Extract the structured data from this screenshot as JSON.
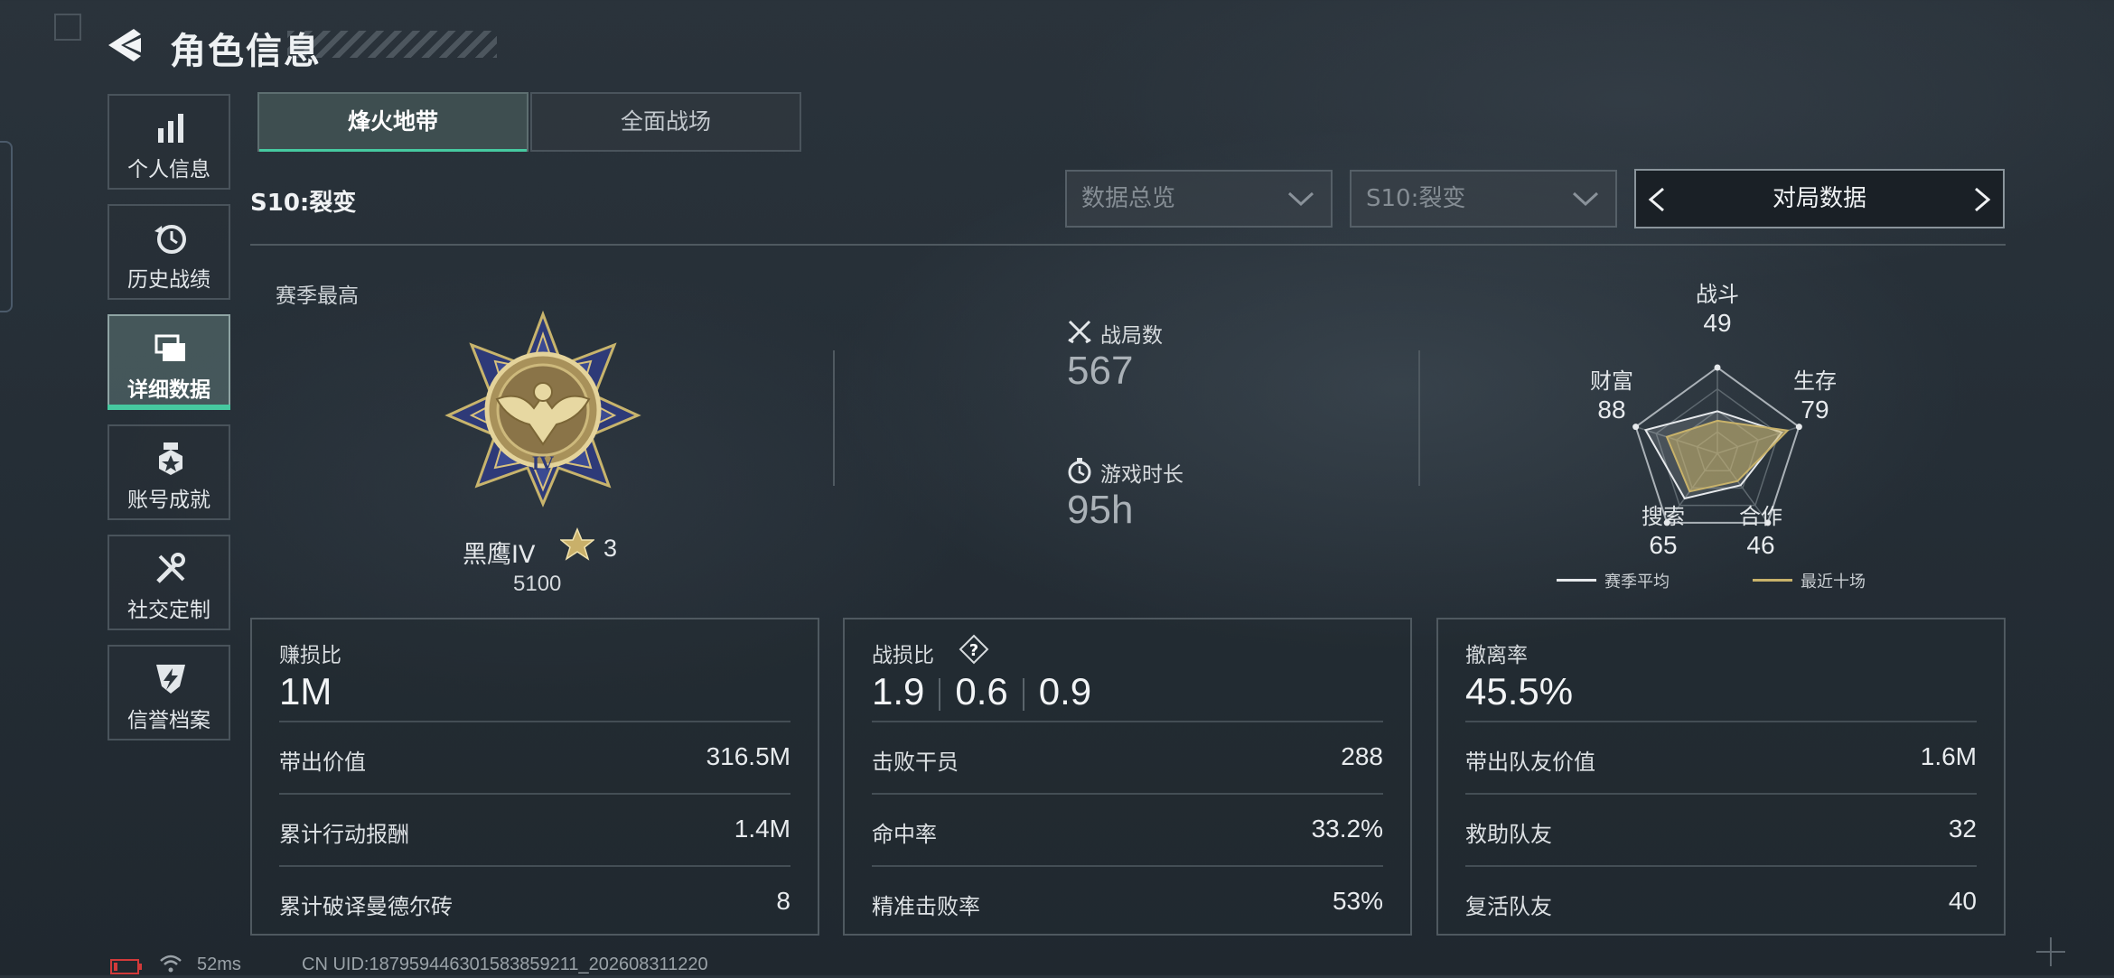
{
  "header": {
    "title": "角色信息"
  },
  "nav": [
    {
      "id": "profile",
      "label": "个人信息",
      "icon": "bar-chart-icon"
    },
    {
      "id": "history",
      "label": "历史战绩",
      "icon": "history-clock-icon"
    },
    {
      "id": "details",
      "label": "详细数据",
      "icon": "folders-icon",
      "active": true
    },
    {
      "id": "achievements",
      "label": "账号成就",
      "icon": "medal-icon"
    },
    {
      "id": "social",
      "label": "社交定制",
      "icon": "tools-icon"
    },
    {
      "id": "credit",
      "label": "信誉档案",
      "icon": "shield-lightning-icon"
    }
  ],
  "tabs": [
    {
      "label": "烽火地带",
      "active": true
    },
    {
      "label": "全面战场",
      "active": false
    }
  ],
  "season": {
    "label": "S10:裂变"
  },
  "filters": {
    "overview": "数据总览",
    "season": "S10:裂变",
    "mode": "对局数据"
  },
  "rank": {
    "peak_label": "赛季最高",
    "name": "黑鹰IV",
    "stars": "3",
    "score": "5100"
  },
  "stats": {
    "matches_label": "战局数",
    "matches": "567",
    "playtime_label": "游戏时长",
    "playtime": "95h"
  },
  "radar": {
    "axes": [
      {
        "label": "战斗",
        "value": "49"
      },
      {
        "label": "生存",
        "value": "79"
      },
      {
        "label": "合作",
        "value": "46"
      },
      {
        "label": "搜索",
        "value": "65"
      },
      {
        "label": "财富",
        "value": "88"
      }
    ],
    "season_values": [
      0.49,
      0.79,
      0.46,
      0.65,
      0.88
    ],
    "recent_values": [
      0.38,
      0.86,
      0.4,
      0.55,
      0.62
    ],
    "legend_season": "赛季平均",
    "legend_recent": "最近十场",
    "color_season": "#e6e9ec",
    "color_recent": "#c8b26a"
  },
  "panels": {
    "profit": {
      "title": "赚损比",
      "big": "1M",
      "rows": [
        {
          "label": "带出价值",
          "value": "316.5M"
        },
        {
          "label": "累计行动报酬",
          "value": "1.4M"
        },
        {
          "label": "累计破译曼德尔砖",
          "value": "8"
        }
      ]
    },
    "combat": {
      "title": "战损比",
      "ratios": [
        "1.9",
        "0.6",
        "0.9"
      ],
      "rows": [
        {
          "label": "击败干员",
          "value": "288"
        },
        {
          "label": "命中率",
          "value": "33.2%"
        },
        {
          "label": "精准击败率",
          "value": "53%"
        }
      ]
    },
    "extract": {
      "title": "撤离率",
      "big": "45.5%",
      "rows": [
        {
          "label": "带出队友价值",
          "value": "1.6M"
        },
        {
          "label": "救助队友",
          "value": "32"
        },
        {
          "label": "复活队友",
          "value": "40"
        }
      ]
    }
  },
  "footer": {
    "ping": "52ms",
    "uid": "CN UID:18795944630158385921​1_202608311220"
  },
  "colors": {
    "accent": "#46c9a0"
  }
}
